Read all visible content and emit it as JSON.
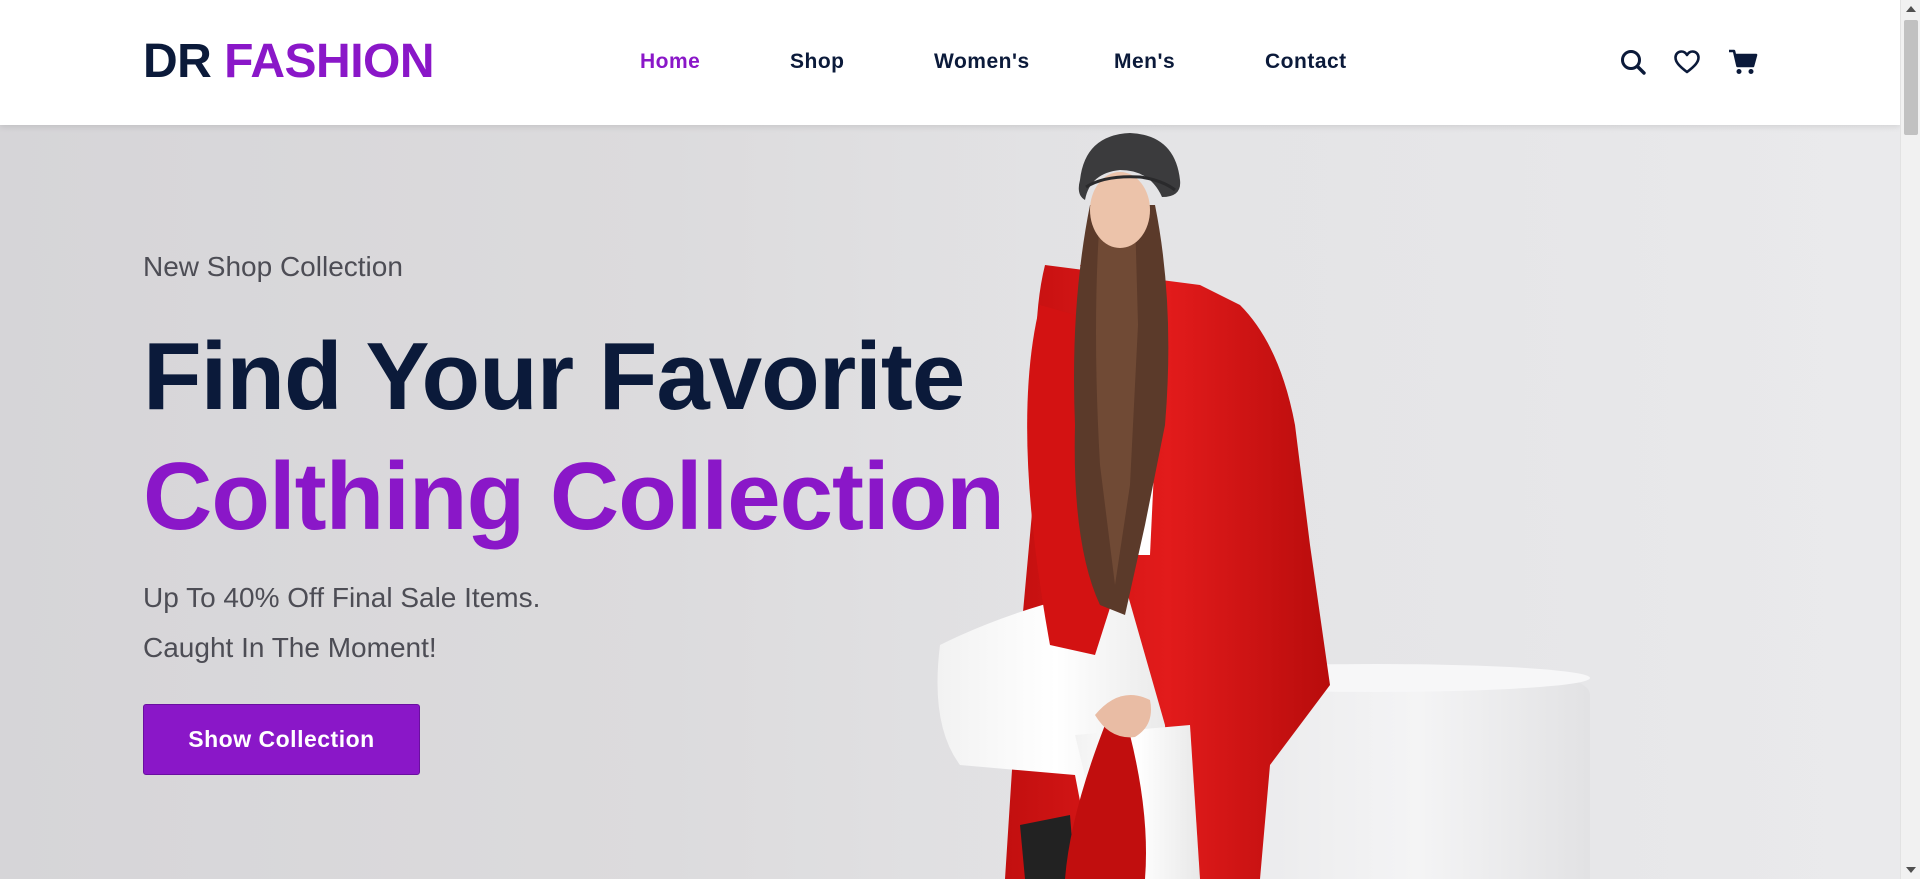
{
  "brand": {
    "part1": "DR",
    "part2": "FASHION"
  },
  "nav": {
    "items": [
      {
        "label": "Home",
        "active": true
      },
      {
        "label": "Shop",
        "active": false
      },
      {
        "label": "Women's",
        "active": false
      },
      {
        "label": "Men's",
        "active": false
      },
      {
        "label": "Contact",
        "active": false
      }
    ]
  },
  "header_icons": [
    "search-icon",
    "heart-icon",
    "cart-icon"
  ],
  "hero": {
    "eyebrow": "New Shop Collection",
    "headline_line1": "Find Your Favorite",
    "headline_line2": "Colthing Collection",
    "sub_line1": "Up To 40% Off Final Sale Items.",
    "sub_line2": "Caught In The Moment!",
    "cta_label": "Show Collection"
  },
  "colors": {
    "accent": "#8a17c8",
    "navy": "#0b1a3a",
    "muted_text": "#4d4d55",
    "hero_bg": "#dcdbdd"
  }
}
